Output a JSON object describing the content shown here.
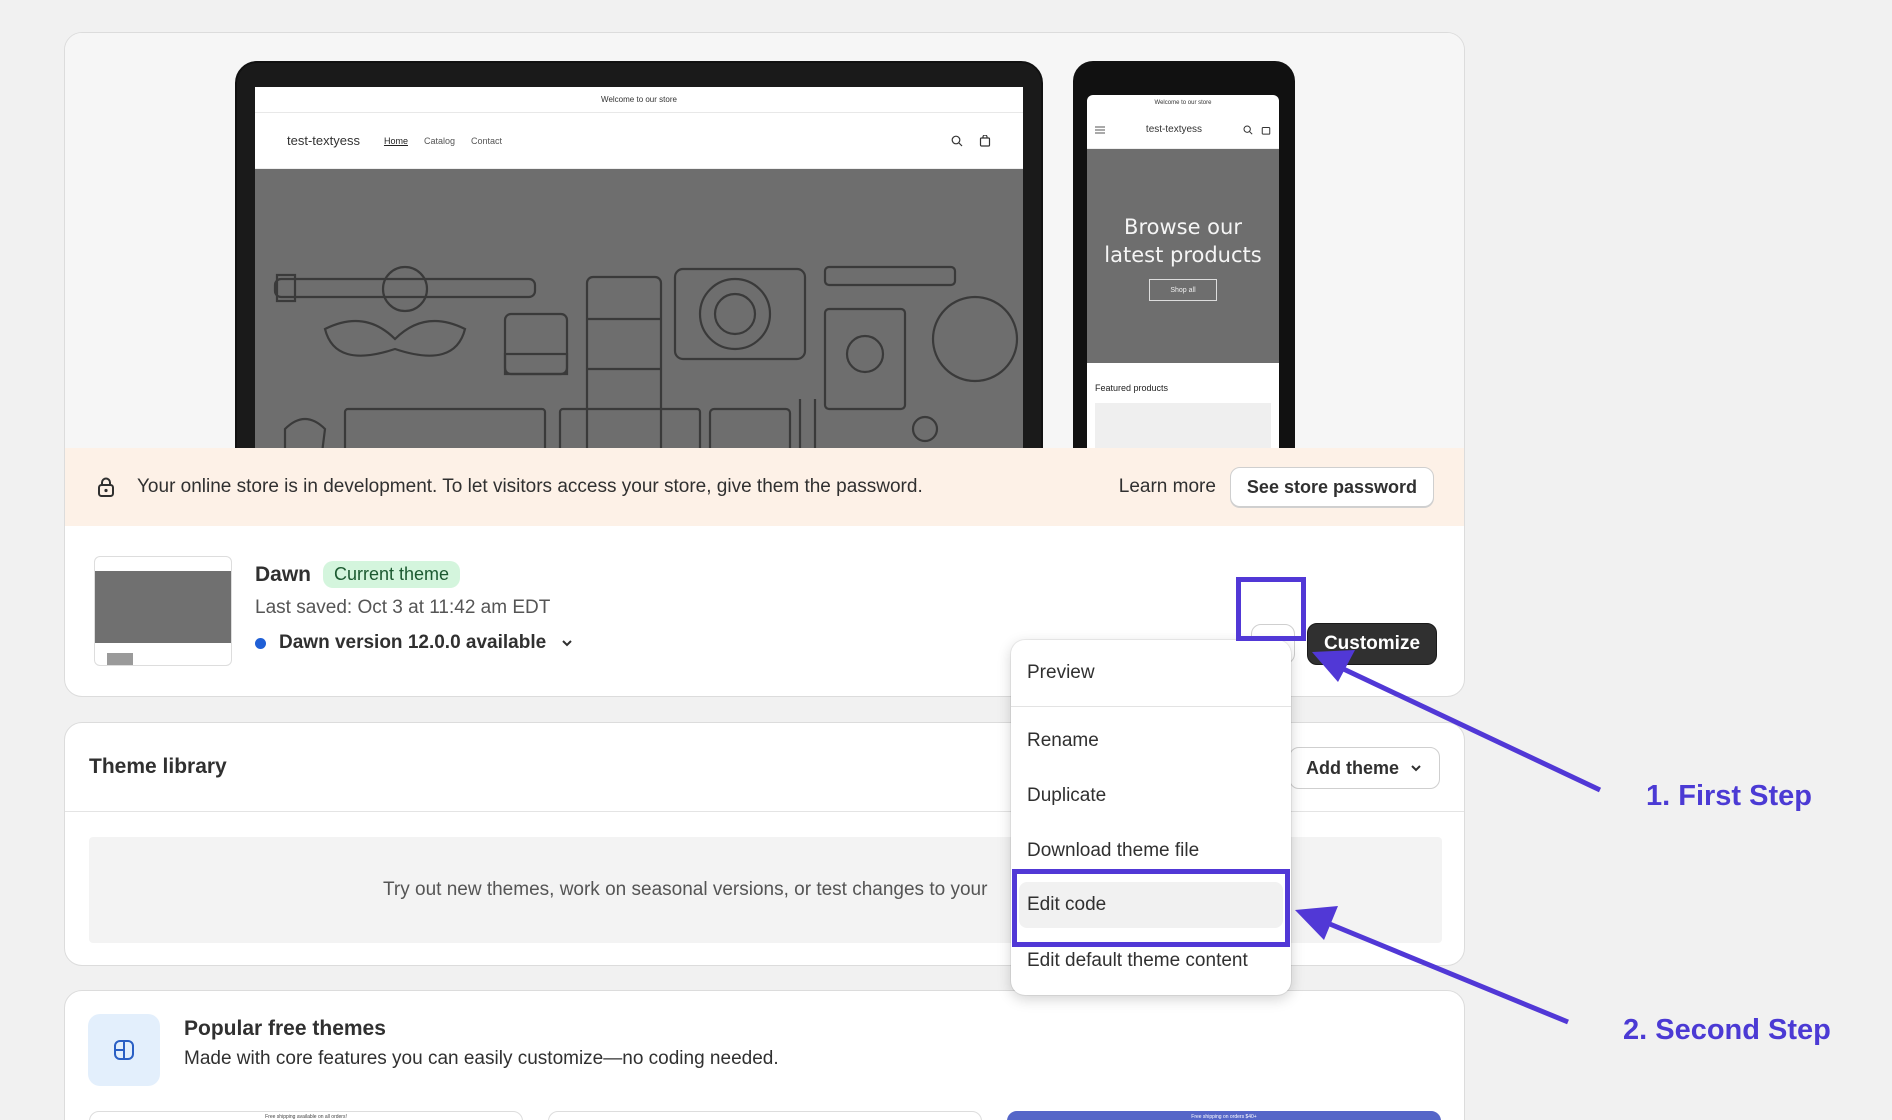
{
  "preview": {
    "announcement": "Welcome to our store",
    "store_name": "test-textyess",
    "nav": [
      "Home",
      "Catalog",
      "Contact"
    ],
    "mobile_hero_title_line1": "Browse our",
    "mobile_hero_title_line2": "latest products",
    "mobile_hero_button": "Shop all",
    "mobile_featured": "Featured products"
  },
  "dev_banner": {
    "message": "Your online store is in development. To let visitors access your store, give them the password.",
    "learn_more": "Learn more",
    "button": "See store password"
  },
  "current_theme": {
    "name": "Dawn",
    "badge": "Current theme",
    "last_saved": "Last saved: Oct 3 at 11:42 am EDT",
    "version": "Dawn version 12.0.0 available",
    "customize": "Customize"
  },
  "menu": {
    "items": [
      "Preview",
      "Rename",
      "Duplicate",
      "Download theme file",
      "Edit code",
      "Edit default theme content"
    ],
    "highlighted": "Edit code"
  },
  "library": {
    "title": "Theme library",
    "add_theme": "Add theme",
    "empty_text": "Try out new themes, work on seasonal versions, or test changes to your"
  },
  "popular": {
    "title": "Popular free themes",
    "subtitle": "Made with core features you can easily customize—no coding needed.",
    "thumb_labels": [
      "Free shipping available on all orders!",
      "",
      "Free shipping on orders $40+"
    ]
  },
  "annotations": {
    "step1": "1. First Step",
    "step2": "2. Second Step",
    "color": "#5138d6"
  }
}
